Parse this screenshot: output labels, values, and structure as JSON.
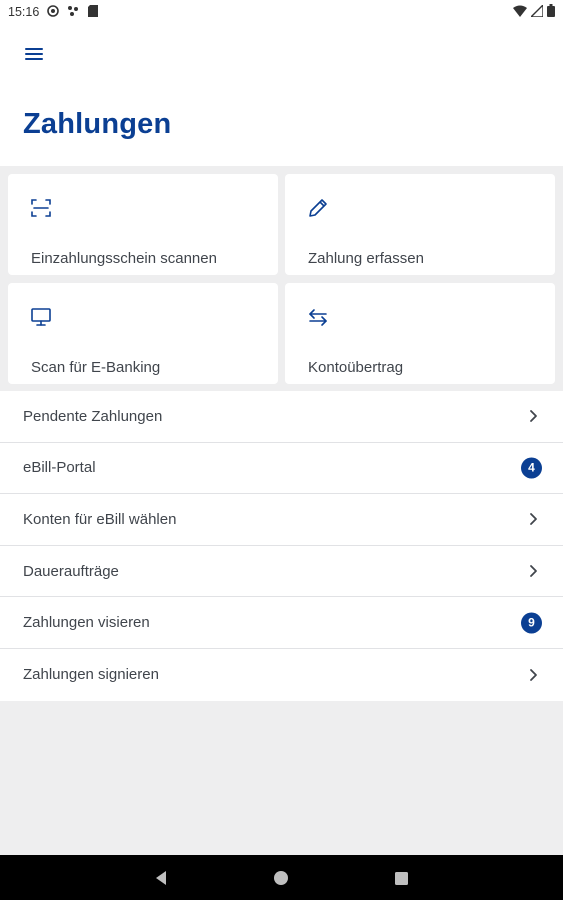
{
  "status_bar": {
    "time": "15:16",
    "left_icons": [
      "at-sign-icon",
      "sync-dots-icon",
      "sd-card-icon"
    ],
    "right_icons": [
      "wifi-icon",
      "signal-icon",
      "battery-icon"
    ]
  },
  "app_bar": {
    "menu_icon": "hamburger-menu-icon"
  },
  "page": {
    "title": "Zahlungen"
  },
  "tiles": [
    {
      "label": "Einzahlungsschein scannen",
      "icon": "scan-frame-icon"
    },
    {
      "label": "Zahlung erfassen",
      "icon": "pencil-icon"
    },
    {
      "label": "Scan für E-Banking",
      "icon": "monitor-icon"
    },
    {
      "label": "Kontoübertrag",
      "icon": "transfer-arrows-icon"
    }
  ],
  "list": [
    {
      "label": "Pendente Zahlungen",
      "trailing": "chevron"
    },
    {
      "label": "eBill-Portal",
      "trailing": "badge",
      "badge": "4"
    },
    {
      "label": "Konten für eBill wählen",
      "trailing": "chevron"
    },
    {
      "label": "Daueraufträge",
      "trailing": "chevron"
    },
    {
      "label": "Zahlungen visieren",
      "trailing": "badge",
      "badge": "9"
    },
    {
      "label": "Zahlungen signieren",
      "trailing": "chevron"
    }
  ],
  "colors": {
    "accent": "#0b3f93",
    "background": "#eeeeef",
    "surface": "#ffffff",
    "text": "#40454c"
  },
  "nav_bar": {
    "buttons": [
      "back-icon",
      "home-icon",
      "recents-icon"
    ]
  }
}
